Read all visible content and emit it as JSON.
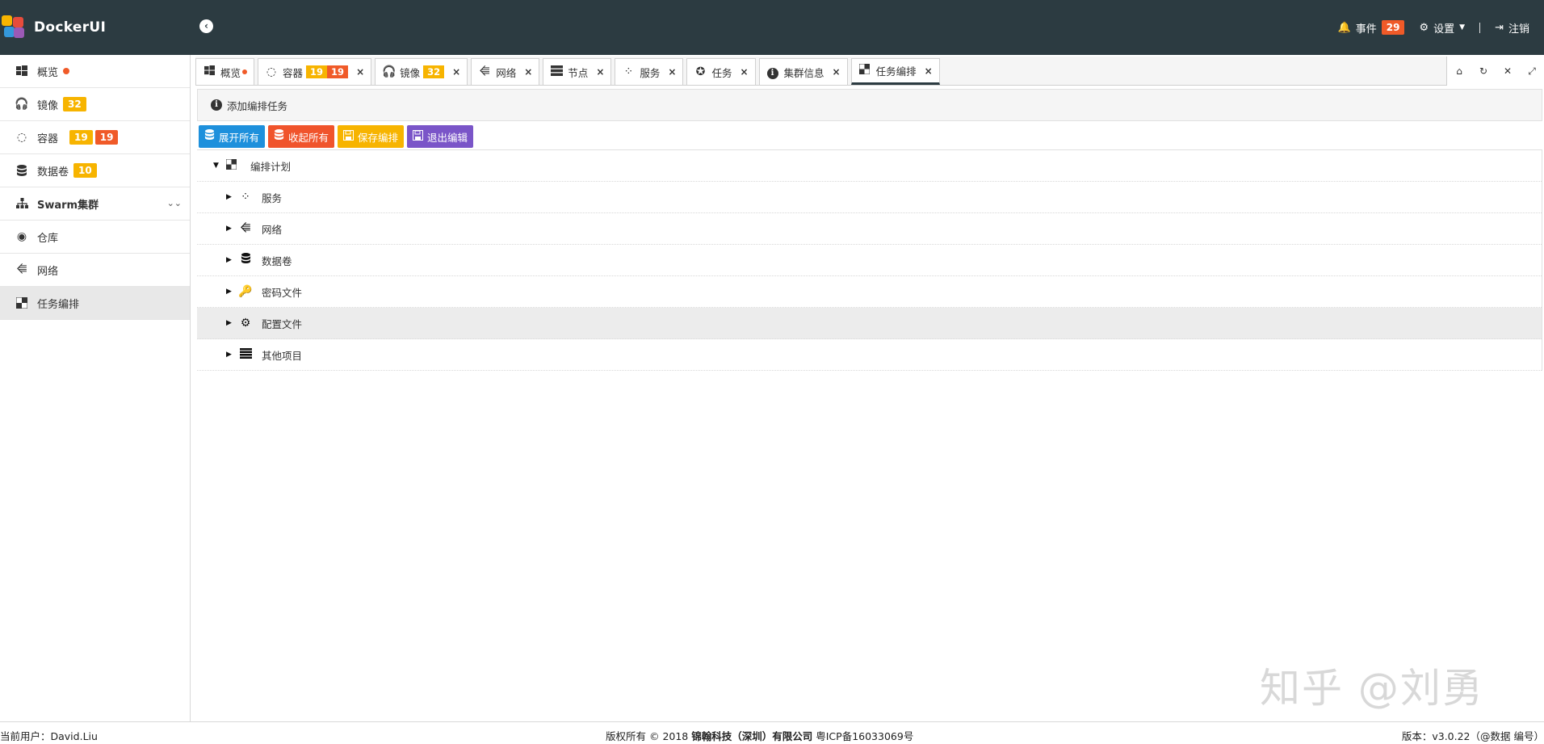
{
  "app": {
    "title": "DockerUI"
  },
  "header": {
    "events_label": "事件",
    "events_count": "29",
    "settings_label": "设置",
    "logout_label": "注销"
  },
  "sidebar": {
    "items": [
      {
        "label": "概览",
        "icon": "windows-icon"
      },
      {
        "label": "镜像",
        "icon": "headphones-icon",
        "badge": "32"
      },
      {
        "label": "容器",
        "icon": "container-icon",
        "badge1": "19",
        "badge2": "19"
      },
      {
        "label": "数据卷",
        "icon": "database-icon",
        "badge": "10"
      },
      {
        "label": "Swarm集群",
        "icon": "sitemap-icon"
      },
      {
        "label": "仓库",
        "icon": "podcast-icon"
      },
      {
        "label": "网络",
        "icon": "usb-icon"
      },
      {
        "label": "任务编排",
        "icon": "checker-icon"
      }
    ]
  },
  "tabs": [
    {
      "label": "概览"
    },
    {
      "label": "容器",
      "badge1": "19",
      "badge2": "19"
    },
    {
      "label": "镜像",
      "badge": "32"
    },
    {
      "label": "网络"
    },
    {
      "label": "节点"
    },
    {
      "label": "服务"
    },
    {
      "label": "任务"
    },
    {
      "label": "集群信息"
    },
    {
      "label": "任务编排"
    }
  ],
  "panel": {
    "title": "添加编排任务",
    "buttons": {
      "expand_all": "展开所有",
      "collapse_all": "收起所有",
      "save": "保存编排",
      "exit": "退出编辑"
    },
    "tree": {
      "root": "编排计划",
      "children": [
        {
          "label": "服务"
        },
        {
          "label": "网络"
        },
        {
          "label": "数据卷"
        },
        {
          "label": "密码文件"
        },
        {
          "label": "配置文件"
        },
        {
          "label": "其他项目"
        }
      ]
    }
  },
  "watermark": "知乎 @刘勇",
  "footer": {
    "current_user": "当前用户：David.Liu",
    "copyright_prefix": "版权所有 © 2018",
    "company": "锦翰科技（深圳）有限公司",
    "icp": "粤ICP备16033069号",
    "version": "版本：v3.0.22（@数据 编号）"
  },
  "colors": {
    "header_bg": "#2c3b41",
    "badge_red": "#f05a28",
    "badge_yellow": "#f7b400",
    "btn_blue": "#1e90dc",
    "btn_red": "#f0542c",
    "btn_purple": "#7a55c8"
  }
}
